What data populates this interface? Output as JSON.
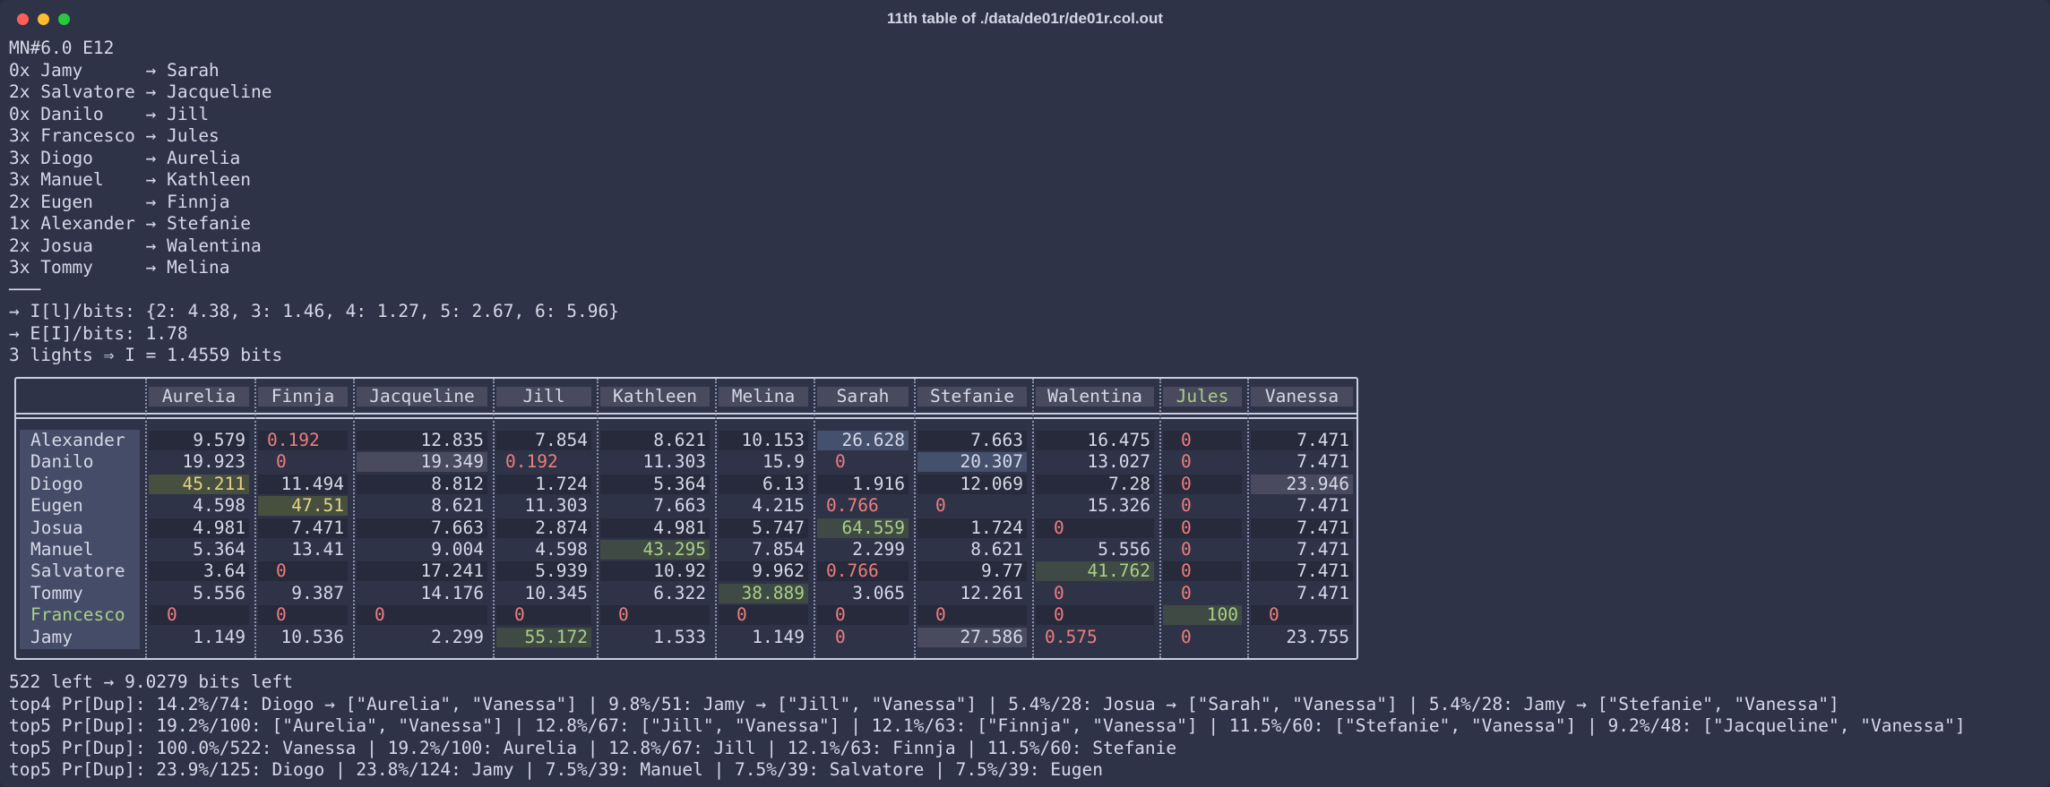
{
  "window": {
    "title": "11th table of ./data/de01r/de01r.col.out"
  },
  "terminal": {
    "pre_lines": [
      "MN#6.0 E12",
      "0x Jamy      → Sarah",
      "2x Salvatore → Jacqueline",
      "0x Danilo    → Jill",
      "3x Francesco → Jules",
      "3x Diogo     → Aurelia",
      "3x Manuel    → Kathleen",
      "2x Eugen     → Finnja",
      "1x Alexander → Stefanie",
      "2x Josua     → Walentina",
      "3x Tommy     → Melina",
      "───",
      "→ I[l]/bits: {2: 4.38, 3: 1.46, 4: 1.27, 5: 2.67, 6: 5.96}",
      "→ E[I]/bits: 1.78",
      "3 lights ⇒ I = 1.4559 bits"
    ],
    "post_lines": [
      "522 left → 9.0279 bits left",
      "top4 Pr[Dup]: 14.2%/74: Diogo → [\"Aurelia\", \"Vanessa\"] | 9.8%/51: Jamy → [\"Jill\", \"Vanessa\"] | 5.4%/28: Josua → [\"Sarah\", \"Vanessa\"] | 5.4%/28: Jamy → [\"Stefanie\", \"Vanessa\"]",
      "top5 Pr[Dup]: 19.2%/100: [\"Aurelia\", \"Vanessa\"] | 12.8%/67: [\"Jill\", \"Vanessa\"] | 12.1%/63: [\"Finnja\", \"Vanessa\"] | 11.5%/60: [\"Stefanie\", \"Vanessa\"] | 9.2%/48: [\"Jacqueline\", \"Vanessa\"]",
      "top5 Pr[Dup]: 100.0%/522: Vanessa | 19.2%/100: Aurelia | 12.8%/67: Jill | 12.1%/63: Finnja | 11.5%/60: Stefanie",
      "top5 Pr[Dup]: 23.9%/125: Diogo | 23.8%/124: Jamy | 7.5%/39: Manuel | 7.5%/39: Salvatore | 7.5%/39: Eugen"
    ]
  },
  "table": {
    "columns": [
      "Aurelia",
      "Finnja",
      "Jacqueline",
      "Jill",
      "Kathleen",
      "Melina",
      "Sarah",
      "Stefanie",
      "Walentina",
      "Jules",
      "Vanessa"
    ],
    "rows": [
      {
        "name": "Alexander",
        "values": [
          "9.579",
          "0.192",
          "12.835",
          "7.854",
          "8.621",
          "10.153",
          "26.628",
          "7.663",
          "16.475",
          "0",
          "7.471"
        ]
      },
      {
        "name": "Danilo",
        "values": [
          "19.923",
          "0",
          "19.349",
          "0.192",
          "11.303",
          "15.9",
          "0",
          "20.307",
          "13.027",
          "0",
          "7.471"
        ]
      },
      {
        "name": "Diogo",
        "values": [
          "45.211",
          "11.494",
          "8.812",
          "1.724",
          "5.364",
          "6.13",
          "1.916",
          "12.069",
          "7.28",
          "0",
          "23.946"
        ]
      },
      {
        "name": "Eugen",
        "values": [
          "4.598",
          "47.51",
          "8.621",
          "11.303",
          "7.663",
          "4.215",
          "0.766",
          "0",
          "15.326",
          "0",
          "7.471"
        ]
      },
      {
        "name": "Josua",
        "values": [
          "4.981",
          "7.471",
          "7.663",
          "2.874",
          "4.981",
          "5.747",
          "64.559",
          "1.724",
          "0",
          "0",
          "7.471"
        ]
      },
      {
        "name": "Manuel",
        "values": [
          "5.364",
          "13.41",
          "9.004",
          "4.598",
          "43.295",
          "7.854",
          "2.299",
          "8.621",
          "5.556",
          "0",
          "7.471"
        ]
      },
      {
        "name": "Salvatore",
        "values": [
          "3.64",
          "0",
          "17.241",
          "5.939",
          "10.92",
          "9.962",
          "0.766",
          "9.77",
          "41.762",
          "0",
          "7.471"
        ]
      },
      {
        "name": "Tommy",
        "values": [
          "5.556",
          "9.387",
          "14.176",
          "10.345",
          "6.322",
          "38.889",
          "3.065",
          "12.261",
          "0",
          "0",
          "7.471"
        ]
      },
      {
        "name": "Francesco",
        "values": [
          "0",
          "0",
          "0",
          "0",
          "0",
          "0",
          "0",
          "0",
          "0",
          "100",
          "0"
        ]
      },
      {
        "name": "Jamy",
        "values": [
          "1.149",
          "10.536",
          "2.299",
          "55.172",
          "1.533",
          "1.149",
          "0",
          "27.586",
          "0.575",
          "0",
          "23.755"
        ]
      }
    ],
    "colors": {
      "zero": "#ee7d7d",
      "known_match": "#a9cf86",
      "highlight_blue": "#45506c",
      "highlight_green": "#3f4a44",
      "highlight_purple": "#4a4a5e"
    }
  }
}
